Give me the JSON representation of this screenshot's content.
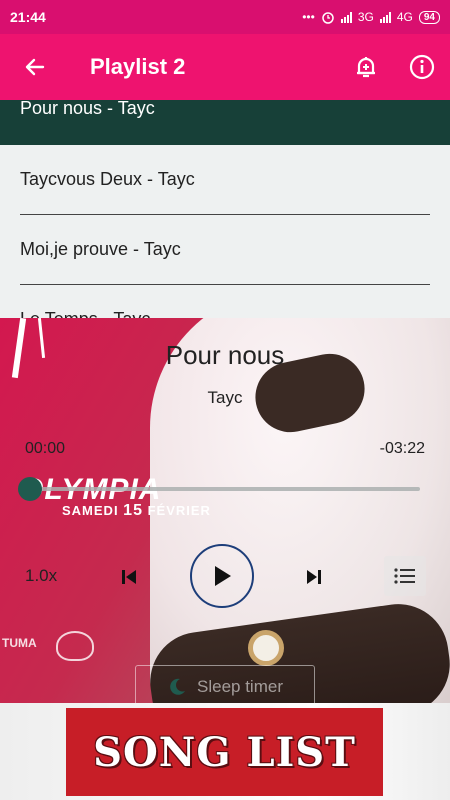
{
  "status_bar": {
    "time": "21:44",
    "dots": "•••",
    "network": "3G",
    "network2": "4G",
    "battery": "94"
  },
  "app_bar": {
    "title": "Playlist 2",
    "back_icon": "arrow-left-icon",
    "alarm_icon": "alarm-add-icon",
    "info_icon": "info-icon"
  },
  "songs": [
    {
      "label": "Pour nous - Tayc"
    },
    {
      "label": "Taycvous Deux - Tayc"
    },
    {
      "label": "Moi,je prouve - Tayc"
    },
    {
      "label": "Le Temps - Tayc"
    }
  ],
  "now_playing": {
    "title": "Pour nous",
    "artist": "Tayc",
    "elapsed": "00:00",
    "remaining": "-03:22",
    "progress": 0.0,
    "speed": "1.0x",
    "sleep_timer_label": "Sleep timer"
  },
  "artwork": {
    "venue": "OLYMPIA",
    "date_prefix": "SAMEDI ",
    "date_day": "15",
    "date_suffix": " FÉVRIER",
    "brand": "TUMA"
  },
  "banner": {
    "label": "SONG LIST"
  },
  "colors": {
    "status_bar": "#d90f6f",
    "app_bar": "#ee136f",
    "active_row": "#174038",
    "seek_accent": "#1f5b4f",
    "banner": "#c71e27"
  }
}
